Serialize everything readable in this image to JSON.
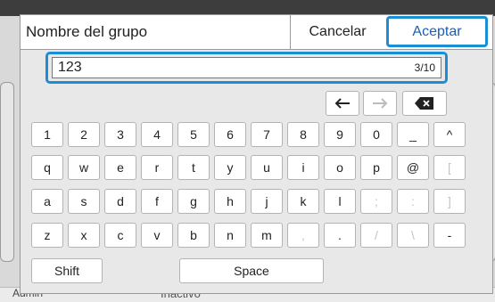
{
  "dialog": {
    "title": "Nombre del grupo",
    "cancel_label": "Cancelar",
    "accept_label": "Aceptar"
  },
  "input": {
    "value": "123",
    "counter": "3/10"
  },
  "keyboard": {
    "row1": [
      "1",
      "2",
      "3",
      "4",
      "5",
      "6",
      "7",
      "8",
      "9",
      "0",
      "_",
      "^"
    ],
    "row2": [
      "q",
      "w",
      "e",
      "r",
      "t",
      "y",
      "u",
      "i",
      "o",
      "p",
      "@",
      "["
    ],
    "row3": [
      "a",
      "s",
      "d",
      "f",
      "g",
      "h",
      "j",
      "k",
      "l",
      ";",
      ":",
      "]"
    ],
    "row4": [
      "z",
      "x",
      "c",
      "v",
      "b",
      "n",
      "m",
      ",",
      ".",
      "/",
      "\\",
      "-"
    ],
    "shift_label": "Shift",
    "space_label": "Space"
  },
  "background": {
    "user_label": "Admin",
    "status_label": "Inactivo"
  },
  "colors": {
    "accent": "#1a8fd6",
    "titlebar_dark": "#3d3d3d"
  }
}
